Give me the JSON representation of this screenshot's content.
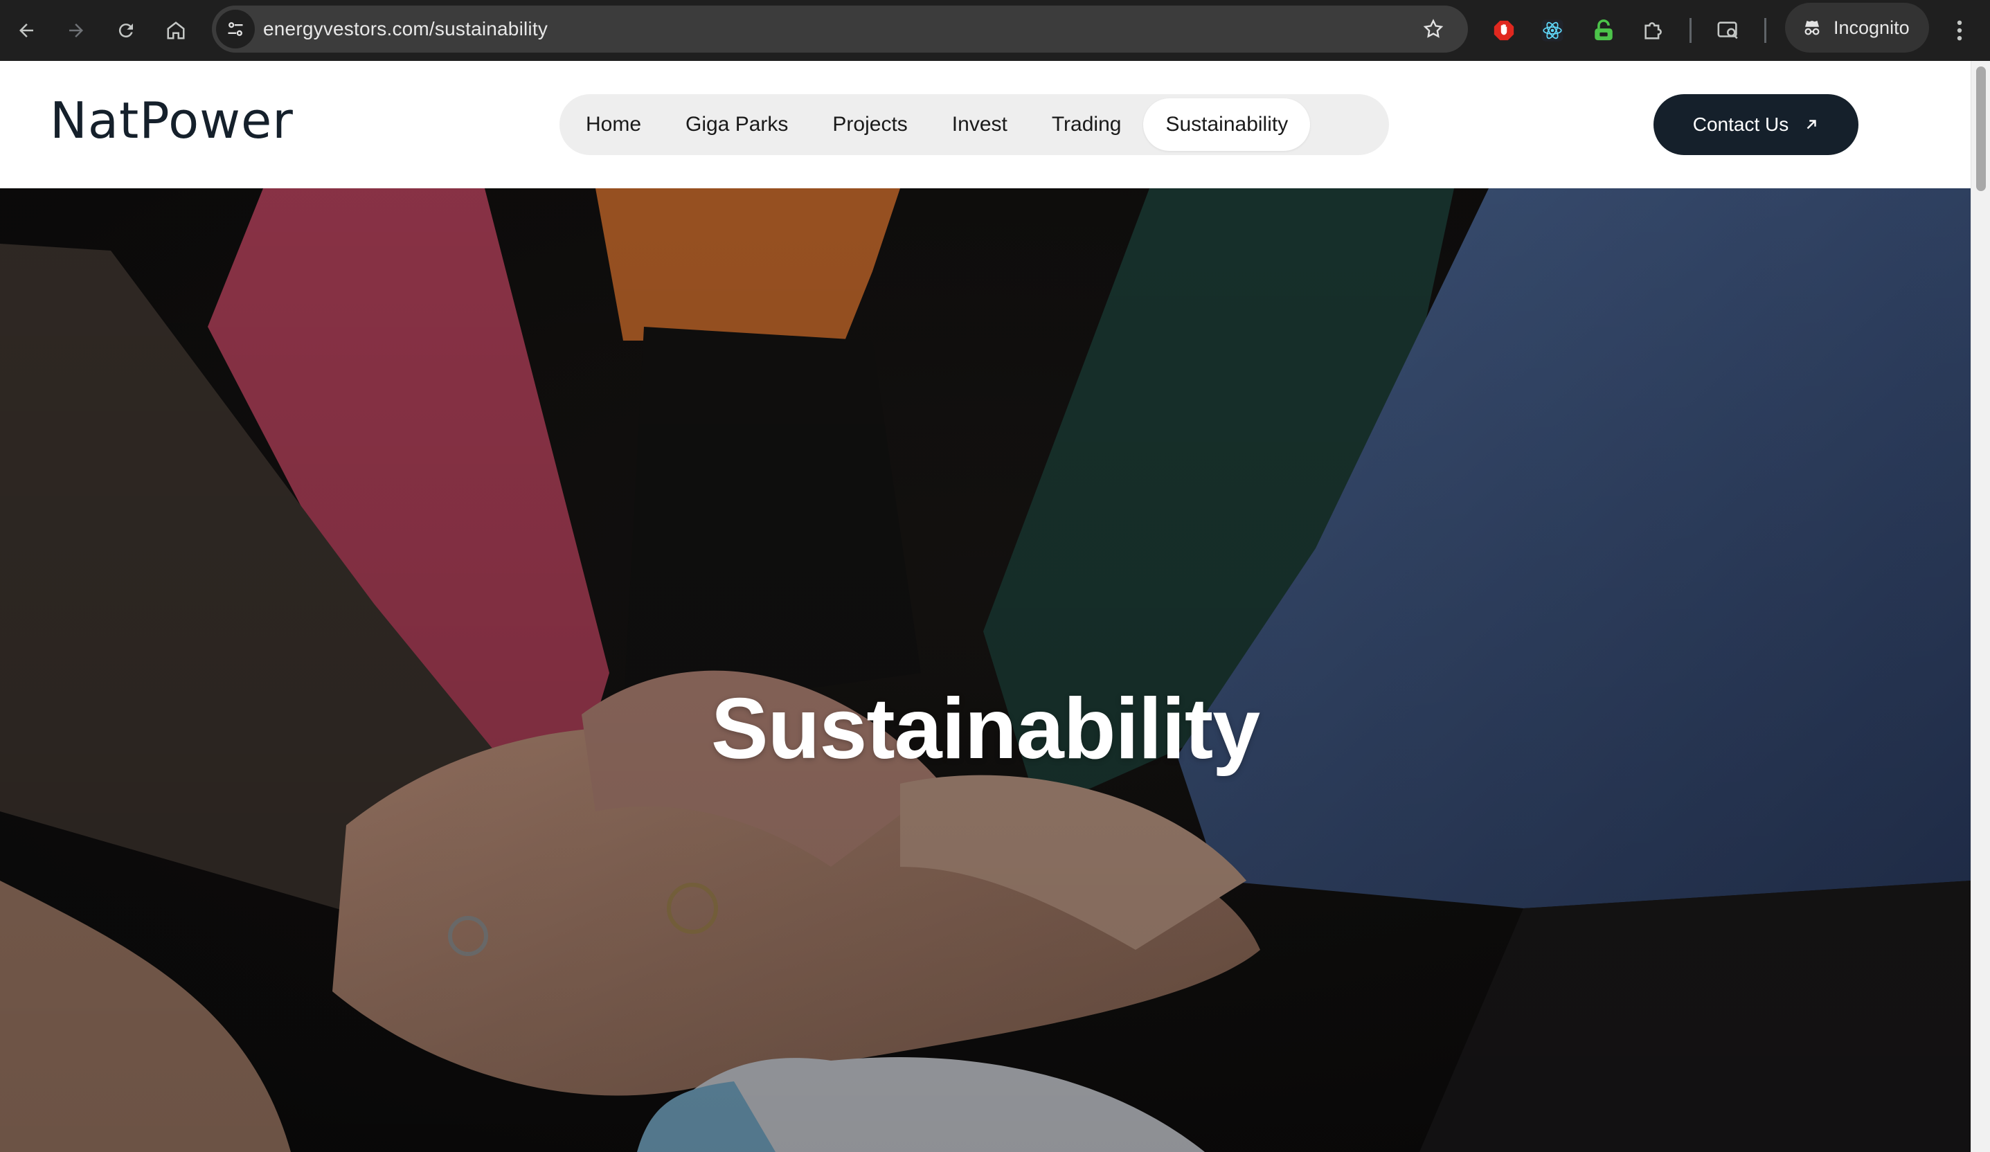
{
  "browser": {
    "url": "energyvestors.com/sustainability",
    "profile_label": "Incognito",
    "icons": [
      "back-icon",
      "forward-icon",
      "reload-icon",
      "home-icon",
      "site-settings-icon",
      "bookmark-star-icon",
      "extension-shield-icon",
      "extension-react-icon",
      "extension-lock-icon",
      "extensions-puzzle-icon",
      "tab-search-icon",
      "incognito-icon",
      "menu-kebab-icon"
    ]
  },
  "site": {
    "logo_text": "NatPower",
    "nav": [
      {
        "label": "Home"
      },
      {
        "label": "Giga Parks"
      },
      {
        "label": "Projects"
      },
      {
        "label": "Invest"
      },
      {
        "label": "Trading"
      },
      {
        "label": "Sustainability"
      }
    ],
    "active_nav": "Sustainability",
    "contact_label": "Contact Us",
    "colors": {
      "brand_dark": "#15202b",
      "nav_pill_bg": "#eeeeee"
    }
  },
  "hero": {
    "title": "Sustainability",
    "image_desc_icon": "hands-together-photo"
  }
}
